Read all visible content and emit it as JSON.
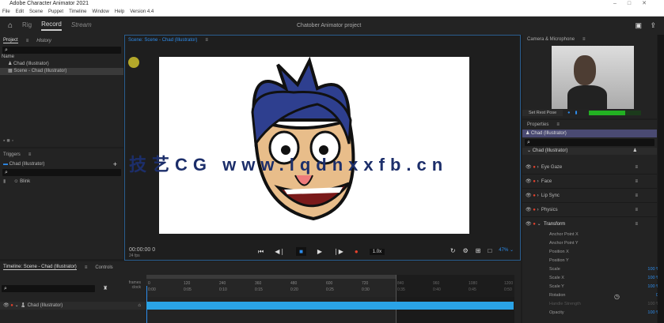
{
  "app": {
    "title": "Adobe Character Animator 2021",
    "menu": [
      "File",
      "Edit",
      "Scene",
      "Puppet",
      "Timeline",
      "Window",
      "Help",
      "Version 4.4"
    ],
    "window_controls": [
      "–",
      "□",
      "✕"
    ]
  },
  "header": {
    "workspaces": [
      "Rig",
      "Record",
      "Stream"
    ],
    "active": "Record",
    "project_name": "Chatober Animator project"
  },
  "project": {
    "tabs": [
      "Project",
      "History"
    ],
    "column": "Name",
    "items": [
      "Chad (Illustrator)",
      "Scene - Chad (Illustrator)"
    ]
  },
  "triggers": {
    "title": "Triggers",
    "puppet": "Chad (Illustrator)",
    "items": [
      "Blink"
    ]
  },
  "scene": {
    "tab": "Scene: Scene - Chad (Illustrator)",
    "timecode": "00:00:00",
    "frame": "0",
    "fps": "24 fps",
    "speed": "1.0x",
    "zoom": "47%"
  },
  "camera": {
    "title": "Camera & Microphone",
    "set_rest_pose": "Set Rest Pose",
    "level": 0.7
  },
  "properties": {
    "title": "Properties",
    "puppet": "Chad (Illustrator)",
    "group": "Chad (Illustrator)",
    "behaviors": [
      "Eye Gaze",
      "Face",
      "Lip Sync",
      "Physics",
      "Transform"
    ],
    "transform": [
      {
        "label": "Anchor Point X",
        "value": "0"
      },
      {
        "label": "Anchor Point Y",
        "value": "0"
      },
      {
        "label": "Position X",
        "value": "0"
      },
      {
        "label": "Position Y",
        "value": "0"
      },
      {
        "label": "Scale",
        "value": "100 %"
      },
      {
        "label": "Scale X",
        "value": "100 %"
      },
      {
        "label": "Scale Y",
        "value": "100 %"
      },
      {
        "label": "Rotation",
        "value": "0°"
      },
      {
        "label": "Handle Strength",
        "value": "100 %"
      },
      {
        "label": "Opacity",
        "value": "100 %"
      }
    ]
  },
  "timeline": {
    "tabs": [
      "Timeline: Scene - Chad (Illustrator)",
      "Controls"
    ],
    "row_labels": [
      "frames",
      "clock"
    ],
    "frames": [
      "0",
      "120",
      "240",
      "360",
      "480",
      "600",
      "720",
      "840",
      "960",
      "1080",
      "1200"
    ],
    "times": [
      "0:00",
      "0:05",
      "0:10",
      "0:15",
      "0:20",
      "0:25",
      "0:30",
      "0:35",
      "0:40",
      "0:45",
      "0:50"
    ],
    "track": "Chad (Illustrator)"
  },
  "watermark": "技艺CG www.lqdnxxfb.cn",
  "colors": {
    "accent": "#2d8ceb",
    "record": "#e8412c",
    "track": "#2aa3e6",
    "selected_puppet": "#4a4a72"
  }
}
